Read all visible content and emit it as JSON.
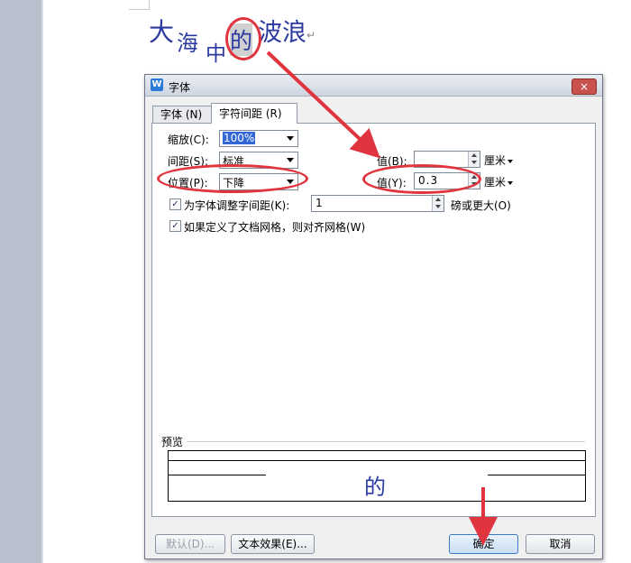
{
  "document": {
    "chars": [
      "大",
      "海",
      "中",
      "的",
      "波",
      "浪"
    ],
    "paragraph_mark": "↵"
  },
  "dialog": {
    "title": "字体",
    "app_icon_letter": "W",
    "close_glyph": "×",
    "tabs": [
      {
        "label": "字体 (N)",
        "active": false
      },
      {
        "label": "字符间距 (R)",
        "active": true
      }
    ],
    "scale": {
      "label": "缩放(C):",
      "value": "100%"
    },
    "spacing": {
      "label": "间距(S):",
      "value": "标准",
      "value_label": "值(B):",
      "value_text": "",
      "unit": "厘米"
    },
    "position": {
      "label": "位置(P):",
      "value": "下降",
      "value_label": "值(Y):",
      "value_text": "0.3",
      "unit": "厘米"
    },
    "kerning": {
      "label": "为字体调整字间距(K):",
      "checked": true,
      "value_text": "1",
      "suffix": "磅或更大(O)"
    },
    "snap_grid": {
      "label": "如果定义了文档网格，则对齐网格(W)",
      "checked": true
    },
    "preview": {
      "label": "预览",
      "char": "的"
    },
    "buttons": {
      "default": "默认(D)...",
      "text_effects": "文本效果(E)...",
      "ok": "确定",
      "cancel": "取消"
    }
  },
  "colors": {
    "annotation": "#e0353f",
    "doc_text": "#2c3aa0"
  }
}
